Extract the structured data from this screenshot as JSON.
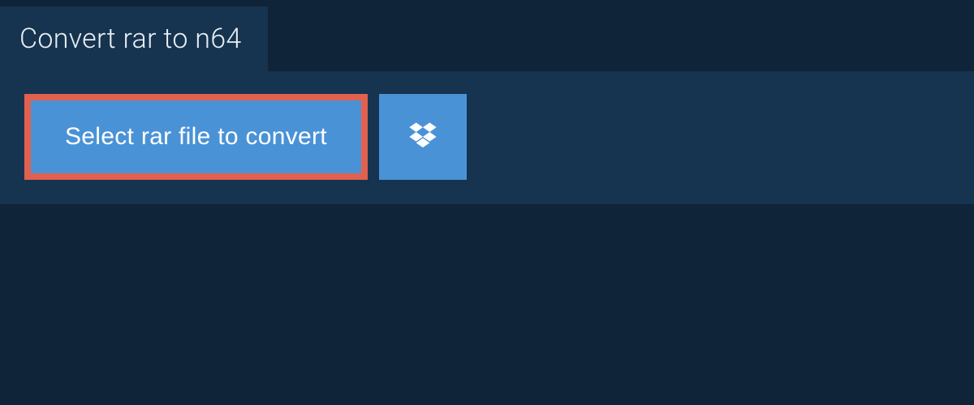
{
  "header": {
    "title": "Convert rar to n64"
  },
  "main": {
    "select_button_label": "Select rar file to convert"
  },
  "colors": {
    "page_bg": "#0f2438",
    "panel_bg": "#16344f",
    "button_bg": "#4a92d6",
    "highlight_border": "#e2614e",
    "text_light": "#e8eef3",
    "text_white": "#ffffff"
  }
}
